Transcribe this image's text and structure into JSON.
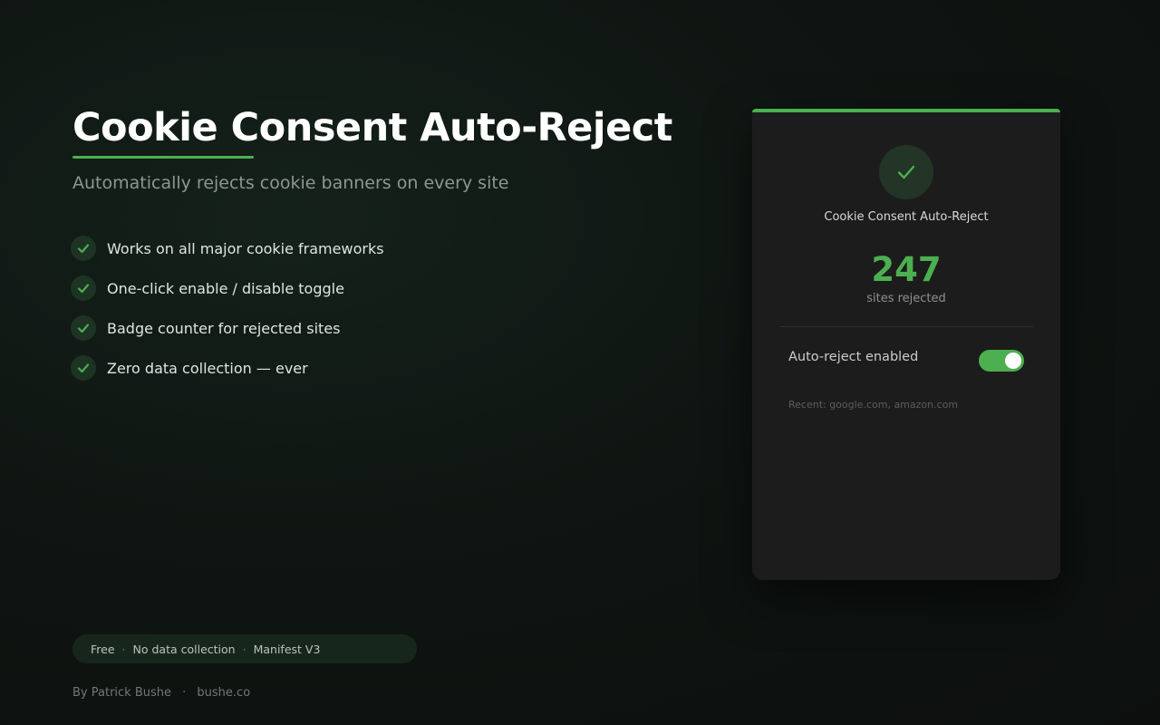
{
  "hero": {
    "title": "Cookie Consent Auto-Reject",
    "subtitle": "Automatically rejects cookie banners on every site",
    "accent_color": "#4caf50"
  },
  "features": [
    {
      "label": "Works on all major cookie frameworks",
      "icon": "check-icon"
    },
    {
      "label": "One-click enable / disable toggle",
      "icon": "check-icon"
    },
    {
      "label": "Badge counter for rejected sites",
      "icon": "check-icon"
    },
    {
      "label": "Zero data collection — ever",
      "icon": "check-icon"
    }
  ],
  "pill": {
    "items": [
      "Free",
      "No data collection",
      "Manifest V3"
    ],
    "separator": "·"
  },
  "footer": {
    "author": "By Patrick Bushe",
    "separator": "·",
    "site": "bushe.co"
  },
  "popup": {
    "icon": "check-icon",
    "extension_name": "Cookie Consent Auto-Reject",
    "count": "247",
    "count_label": "sites rejected",
    "toggle_label": "Auto-reject enabled",
    "toggle_on": true,
    "recent": "Recent: google.com, amazon.com"
  }
}
